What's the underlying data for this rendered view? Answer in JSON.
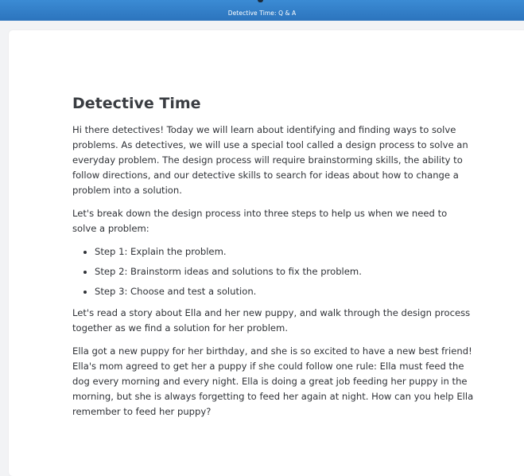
{
  "header": {
    "title": "Detective Time: Q & A"
  },
  "article": {
    "heading": "Detective Time",
    "paragraphs": [
      "Hi there detectives! Today we will learn about identifying and finding ways to solve problems. As detectives, we will use a special tool called a design process to solve an everyday problem. The design process will require brainstorming skills, the ability to follow directions, and our detective skills to search for ideas about how to change a problem into a solution.",
      "Let's break down the design process into three steps to help us when we need to solve a problem:"
    ],
    "steps": [
      "Step 1: Explain the problem.",
      "Step 2: Brainstorm ideas and solutions to fix the problem.",
      "Step 3: Choose and test a solution."
    ],
    "closing_paragraphs": [
      "Let's read a story about Ella and her new puppy, and walk through the design process together as we find a solution for her problem.",
      "Ella got a new puppy for her birthday, and she is so excited to have a new best friend! Ella's mom agreed to get her a puppy if she could follow one rule: Ella must feed the dog every morning and every night. Ella is doing a great job feeding her puppy in the morning, but she is always forgetting to feed her again at night. How can you help Ella remember to feed her puppy?"
    ]
  },
  "colors": {
    "header_bar": "#2f7cc6",
    "page_background": "#f2f3f5",
    "card_background": "#ffffff",
    "text": "#2f3237"
  }
}
